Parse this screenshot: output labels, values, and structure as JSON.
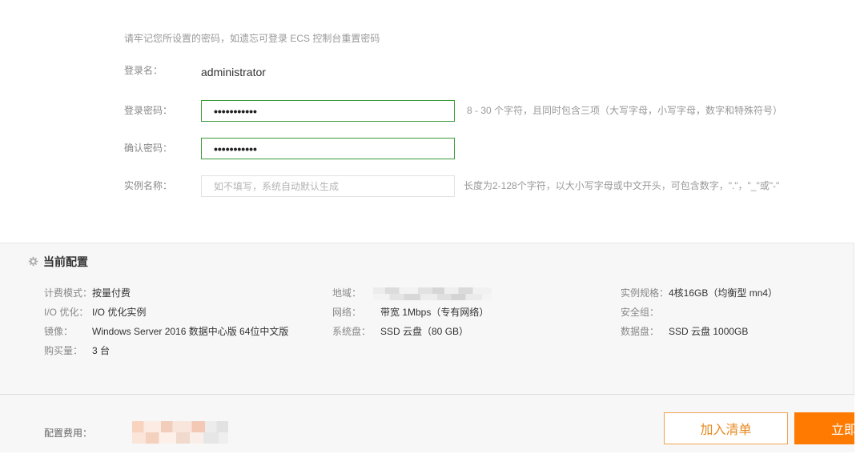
{
  "notice": "请牢记您所设置的密码，如遗忘可登录 ECS 控制台重置密码",
  "form": {
    "login_name": {
      "label": "登录名：",
      "value": "administrator"
    },
    "password": {
      "label": "登录密码：",
      "value": "•••••••••••",
      "hint": "8 - 30 个字符，且同时包含三项（大写字母，小写字母，数字和特殊符号）"
    },
    "confirm_password": {
      "label": "确认密码：",
      "value": "•••••••••••"
    },
    "instance_name": {
      "label": "实例名称：",
      "value": "",
      "placeholder": "如不填写，系统自动默认生成",
      "hint": "长度为2-128个字符，以大小写字母或中文开头，可包含数字，\".\"，\"_\"或\"-\""
    }
  },
  "config": {
    "title": "当前配置",
    "title_icon": "gear-icon",
    "items": [
      {
        "label": "计费模式：",
        "value": "按量付费"
      },
      {
        "label": "地域："
      },
      {
        "label": "实例规格：",
        "value": "4核16GB（均衡型 mn4）"
      },
      {
        "label": "I/O 优化：",
        "value": "I/O 优化实例"
      },
      {
        "label": "网络：",
        "value": "带宽 1Mbps（专有网络）"
      },
      {
        "label": "安全组：",
        "value": ""
      },
      {
        "label": "镜像：",
        "value": "Windows Server 2016 数据中心版 64位中文版"
      },
      {
        "label": "系统盘：",
        "value": "SSD 云盘（80 GB）"
      },
      {
        "label": "数据盘：",
        "value": "SSD 云盘 1000GB"
      },
      {
        "label": "购买量：",
        "value": "3 台"
      }
    ]
  },
  "footer": {
    "fee_label": "配置费用：",
    "add_to_list_label": "加入清单",
    "buy_now_label": "立即"
  },
  "colors": {
    "accent": "#ff7a00",
    "accent_outline": "#f0a550",
    "accent_text": "#e8891f",
    "valid_border": "#3a9a3a",
    "panel_background": "#f7f7f7"
  }
}
